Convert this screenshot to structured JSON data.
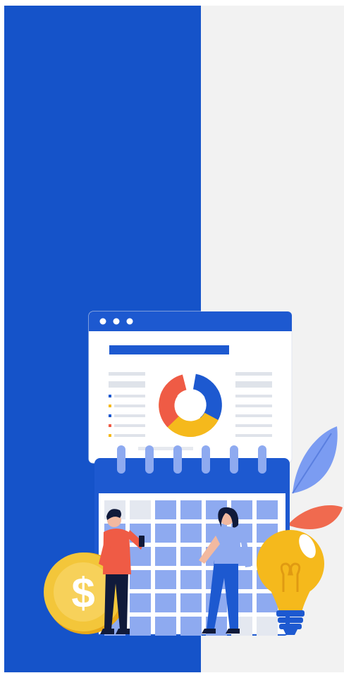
{
  "illustration": {
    "theme": "business planning with calendar, analytics dashboard, coin and idea bulb",
    "colors": {
      "primary_blue": "#1553c9",
      "panel_gray": "#f2f2f2",
      "window_bar": "#1d59d0",
      "calendar_cell": "#8eaaf0",
      "chart_red": "#ef5b45",
      "chart_yellow": "#f5b91c",
      "chart_blue": "#1d59d0",
      "coin_gold": "#f3c63a",
      "leaf_blue": "#7b9cf2",
      "leaf_red": "#f06a4f"
    },
    "icons": [
      "browser-window-icon",
      "donut-chart-icon",
      "calendar-icon",
      "dollar-coin-icon",
      "lightbulb-icon",
      "leaf-icon"
    ],
    "coin_symbol": "$"
  }
}
